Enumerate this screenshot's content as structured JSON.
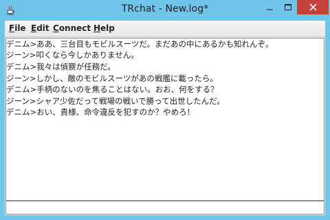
{
  "window": {
    "title": "TRchat - New.log*",
    "controls": {
      "minimize": "—",
      "maximize": "□",
      "close": "✕"
    }
  },
  "menu": [
    {
      "label": "File",
      "mnemonic": "F",
      "rest": "ile"
    },
    {
      "label": "Edit",
      "mnemonic": "E",
      "rest": "dit"
    },
    {
      "label": "Connect",
      "mnemonic": "C",
      "rest": "onnect"
    },
    {
      "label": "Help",
      "mnemonic": "H",
      "rest": "elp"
    }
  ],
  "chat": {
    "lines": [
      "デニム>ああ、三台目もモビルスーツだ。まだあの中にあるかも知れんぞ。",
      "ジーン>叩くなら今しかありません。",
      "デニム>我々は偵察が任務だ。",
      "ジーン>しかし、敵のモビルスーツがあの戦艦に載ったら。",
      "デニム>手柄のないのを焦ることはない。おお、何をする？",
      "ジーン>シャア少佐だって戦場の戦いで勝って出世したんだ。",
      "デニム>おい、貴様、命令違反を犯すのか？やめろ！"
    ]
  },
  "input": {
    "value": ""
  },
  "colors": {
    "titlebar": "#6fc6ea",
    "close": "#c7413b"
  },
  "icons": {
    "app": "java-cup-icon"
  }
}
